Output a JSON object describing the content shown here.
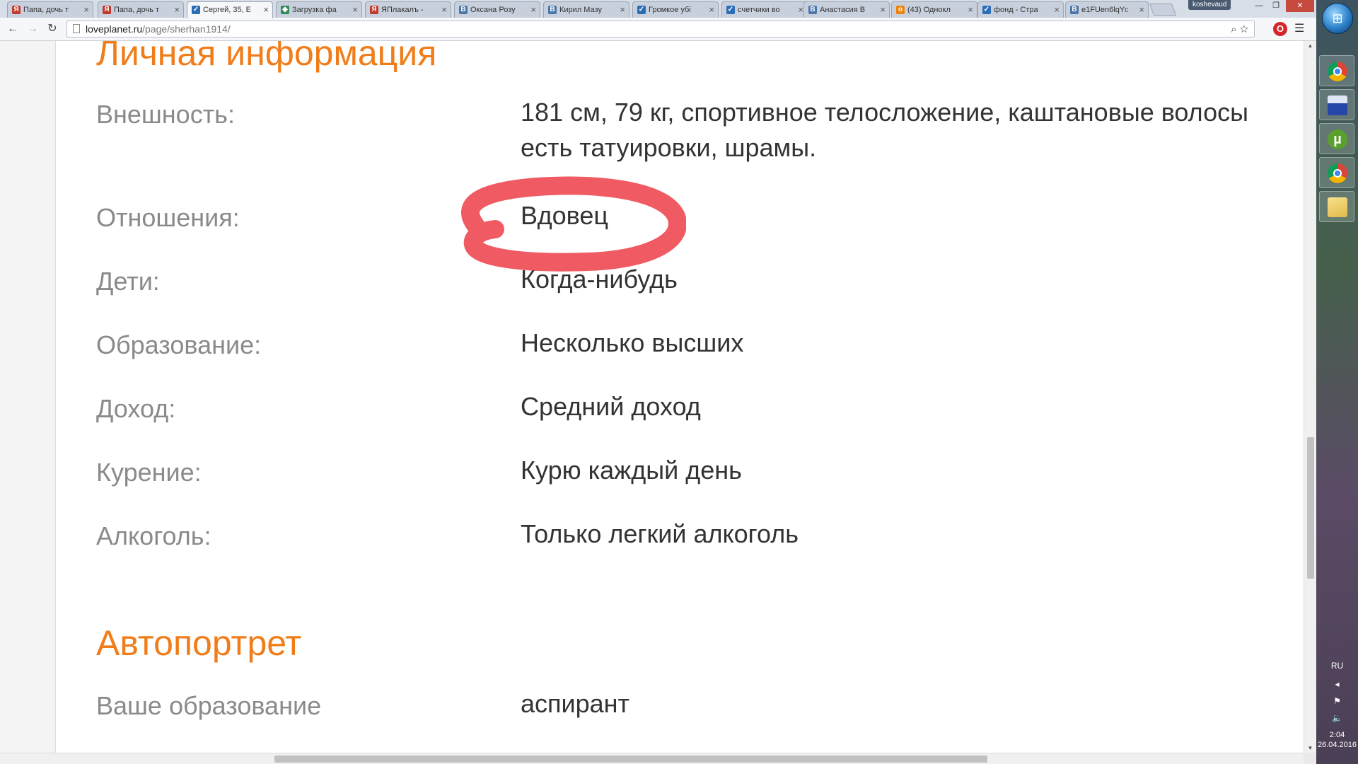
{
  "browser": {
    "tabs": [
      {
        "title": "Папа, дочь т",
        "icon": "yaplakal-icon",
        "icon_color": "#c0392b",
        "active": false
      },
      {
        "title": "Папа, дочь т",
        "icon": "yaplakal-icon",
        "icon_color": "#c0392b",
        "active": false
      },
      {
        "title": "Сергей, 35, Е",
        "icon": "loveplanet-icon",
        "icon_color": "#2a6fb5",
        "active": true
      },
      {
        "title": "Загрузка фа",
        "icon": "upload-icon",
        "icon_color": "#2e8b57",
        "active": false
      },
      {
        "title": "ЯПлакалъ -",
        "icon": "yaplakal-icon",
        "icon_color": "#c0392b",
        "active": false
      },
      {
        "title": "Оксана Розу",
        "icon": "vk-icon",
        "icon_color": "#4a76a8",
        "active": false
      },
      {
        "title": "Кирил Мазу",
        "icon": "vk-icon",
        "icon_color": "#4a76a8",
        "active": false
      },
      {
        "title": "Громкое убі",
        "icon": "vk-blue-icon",
        "icon_color": "#2a6fb5",
        "active": false
      },
      {
        "title": "счетчики во",
        "icon": "vk-blue-icon",
        "icon_color": "#2a6fb5",
        "active": false
      },
      {
        "title": "Анастасия В",
        "icon": "vk-icon",
        "icon_color": "#4a76a8",
        "active": false
      },
      {
        "title": "(43) Однокл",
        "icon": "odnoklassniki-icon",
        "icon_color": "#ee8208",
        "active": false
      },
      {
        "title": "фонд - Стра",
        "icon": "vk-blue-icon",
        "icon_color": "#2a6fb5",
        "active": false
      },
      {
        "title": "e1FUen6lqYc",
        "icon": "vk-icon",
        "icon_color": "#4a76a8",
        "active": false
      }
    ],
    "user": "koshevaud",
    "url_host": "loveplanet.ru",
    "url_path": "/page/sherhan1914/"
  },
  "profile": {
    "personal_info": {
      "title": "Личная информация",
      "rows": [
        {
          "label": "Внешность:",
          "value": "181 см, 79 кг, спортивное телосложение, каштановые волосы",
          "value2": "есть татуировки, шрамы."
        },
        {
          "label": "Отношения:",
          "value": "Вдовец"
        },
        {
          "label": "Дети:",
          "value": "Когда-нибудь"
        },
        {
          "label": "Образование:",
          "value": "Несколько высших"
        },
        {
          "label": "Доход:",
          "value": "Средний доход"
        },
        {
          "label": "Курение:",
          "value": "Курю каждый день"
        },
        {
          "label": "Алкоголь:",
          "value": "Только легкий алкоголь"
        }
      ]
    },
    "self_portrait": {
      "title": "Автопортрет",
      "rows": [
        {
          "label": "Ваше образование",
          "value": "аспирант"
        }
      ]
    },
    "highlight_color": "#ef4c55",
    "accent_color": "#f07d1a"
  },
  "taskbar": {
    "language": "RU",
    "time": "2:04",
    "date": "26.04.2016"
  }
}
